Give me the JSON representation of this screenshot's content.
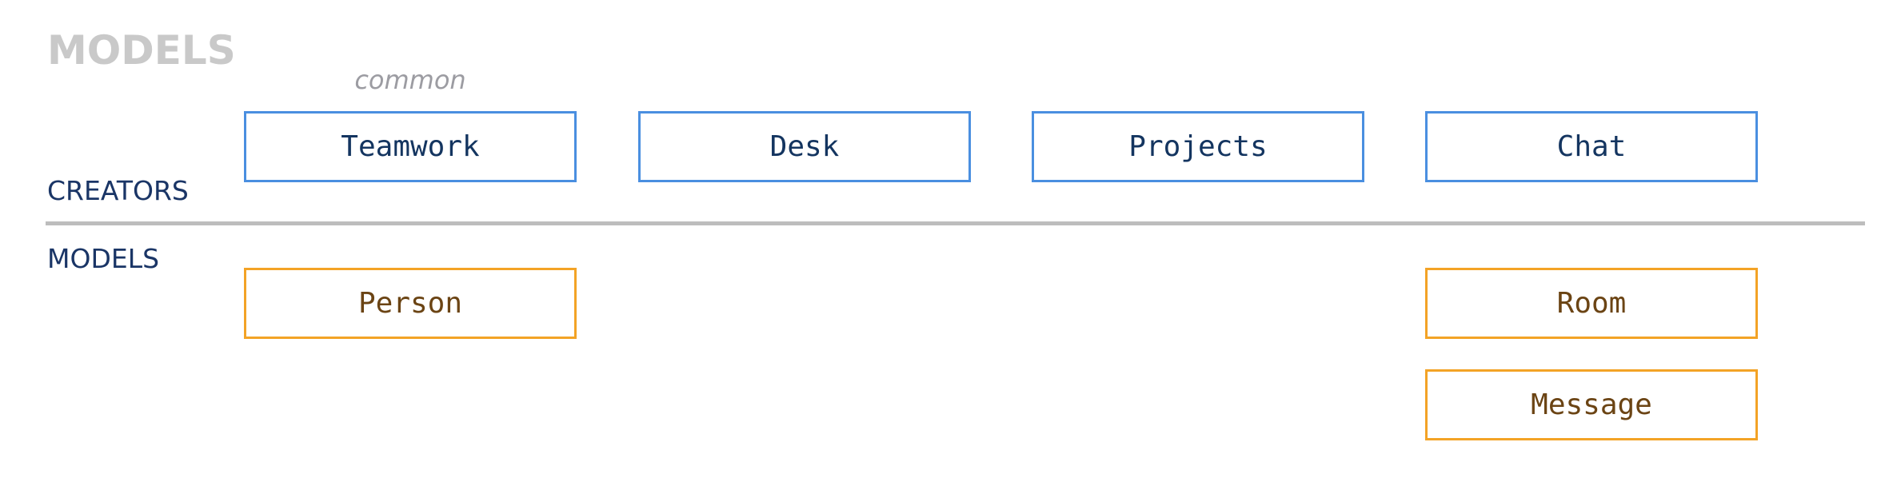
{
  "title": "MODELS",
  "column_caption": "common",
  "row_labels": {
    "creators": "CREATORS",
    "models": "MODELS"
  },
  "creators": [
    {
      "label": "Teamwork"
    },
    {
      "label": "Desk"
    },
    {
      "label": "Projects"
    },
    {
      "label": "Chat"
    }
  ],
  "models": {
    "person": "Person",
    "room": "Room",
    "message": "Message"
  },
  "colors": {
    "creator_border": "#4a8fe0",
    "model_border": "#f3a326",
    "divider": "#bdbdbd",
    "title": "#c9c9c9",
    "row_label": "#1a3566"
  }
}
